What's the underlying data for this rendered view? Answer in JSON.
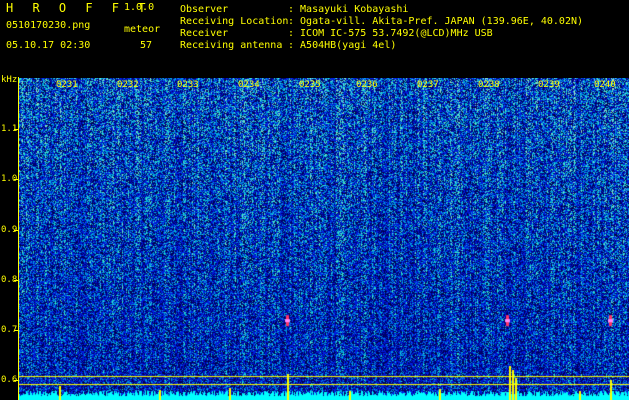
{
  "app": {
    "title": "H R O F F T",
    "version": "1.0.0",
    "filename": "0510170230.png",
    "datetime": "05.10.17 02:30"
  },
  "meteor": {
    "label": "meteor",
    "count": "57"
  },
  "info": [
    {
      "label": "Observer",
      "value": ": Masayuki Kobayashi"
    },
    {
      "label": "Receiving Location",
      "value": ": Ogata-vill. Akita-Pref. JAPAN (139.96E, 40.02N)"
    },
    {
      "label": "Receiver",
      "value": ": ICOM IC-575 53.7492(@LCD)MHz USB"
    },
    {
      "label": "Receiving antenna",
      "value": ": A504HB(yagi 4el)"
    }
  ],
  "axis": {
    "unit": "kHz",
    "freq_labels": [
      "1.1",
      "1.0",
      "0.9",
      "0.8",
      "0.7",
      "0.6"
    ],
    "time_labels": [
      "0231",
      "0232",
      "0233",
      "0234",
      "0235",
      "0236",
      "0237",
      "0238",
      "0239",
      "0240"
    ],
    "freq_range": [
      0.57,
      1.175
    ]
  },
  "colors": {
    "background": "#000000",
    "label": "#ffff00",
    "accent": "#00ff66",
    "baseline": "#00ffff"
  },
  "spectrogram": {
    "meteor_echoes": [
      {
        "time": "02:35",
        "freq": 0.72
      },
      {
        "time": "02:38",
        "freq": 0.72
      },
      {
        "time": "02:40",
        "freq": 0.72
      }
    ]
  }
}
